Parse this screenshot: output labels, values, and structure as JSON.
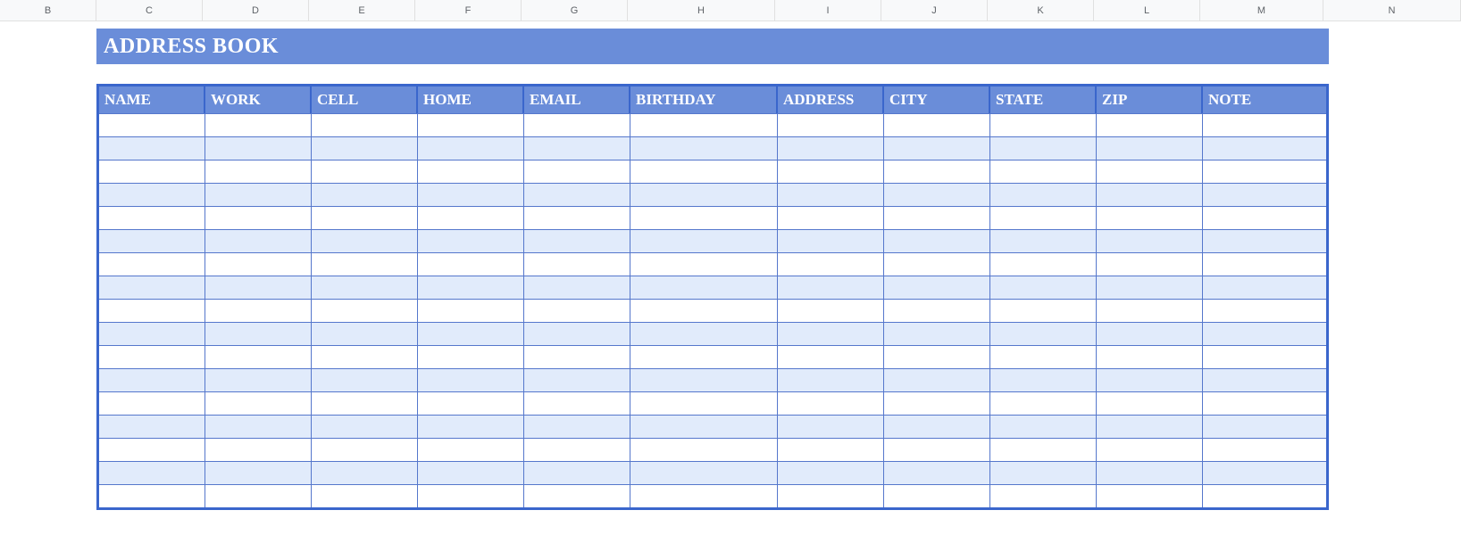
{
  "columnLetters": [
    "B",
    "C",
    "D",
    "E",
    "F",
    "G",
    "H",
    "I",
    "J",
    "K",
    "L",
    "M",
    "N"
  ],
  "title": "ADDRESS BOOK",
  "table": {
    "headers": [
      "NAME",
      "WORK",
      "CELL",
      "HOME",
      "EMAIL",
      "BIRTHDAY",
      "ADDRESS",
      "CITY",
      "STATE",
      "ZIP",
      "NOTE"
    ],
    "rows": [
      [
        "",
        "",
        "",
        "",
        "",
        "",
        "",
        "",
        "",
        "",
        ""
      ],
      [
        "",
        "",
        "",
        "",
        "",
        "",
        "",
        "",
        "",
        "",
        ""
      ],
      [
        "",
        "",
        "",
        "",
        "",
        "",
        "",
        "",
        "",
        "",
        ""
      ],
      [
        "",
        "",
        "",
        "",
        "",
        "",
        "",
        "",
        "",
        "",
        ""
      ],
      [
        "",
        "",
        "",
        "",
        "",
        "",
        "",
        "",
        "",
        "",
        ""
      ],
      [
        "",
        "",
        "",
        "",
        "",
        "",
        "",
        "",
        "",
        "",
        ""
      ],
      [
        "",
        "",
        "",
        "",
        "",
        "",
        "",
        "",
        "",
        "",
        ""
      ],
      [
        "",
        "",
        "",
        "",
        "",
        "",
        "",
        "",
        "",
        "",
        ""
      ],
      [
        "",
        "",
        "",
        "",
        "",
        "",
        "",
        "",
        "",
        "",
        ""
      ],
      [
        "",
        "",
        "",
        "",
        "",
        "",
        "",
        "",
        "",
        "",
        ""
      ],
      [
        "",
        "",
        "",
        "",
        "",
        "",
        "",
        "",
        "",
        "",
        ""
      ],
      [
        "",
        "",
        "",
        "",
        "",
        "",
        "",
        "",
        "",
        "",
        ""
      ],
      [
        "",
        "",
        "",
        "",
        "",
        "",
        "",
        "",
        "",
        "",
        ""
      ],
      [
        "",
        "",
        "",
        "",
        "",
        "",
        "",
        "",
        "",
        "",
        ""
      ],
      [
        "",
        "",
        "",
        "",
        "",
        "",
        "",
        "",
        "",
        "",
        ""
      ],
      [
        "",
        "",
        "",
        "",
        "",
        "",
        "",
        "",
        "",
        "",
        ""
      ],
      [
        "",
        "",
        "",
        "",
        "",
        "",
        "",
        "",
        "",
        "",
        ""
      ]
    ]
  },
  "columnWidths": {
    "table": [
      "w-c",
      "w-d",
      "w-e",
      "w-f",
      "w-g",
      "w-h",
      "w-i",
      "w-j",
      "w-k",
      "w-l",
      "w-m"
    ]
  }
}
